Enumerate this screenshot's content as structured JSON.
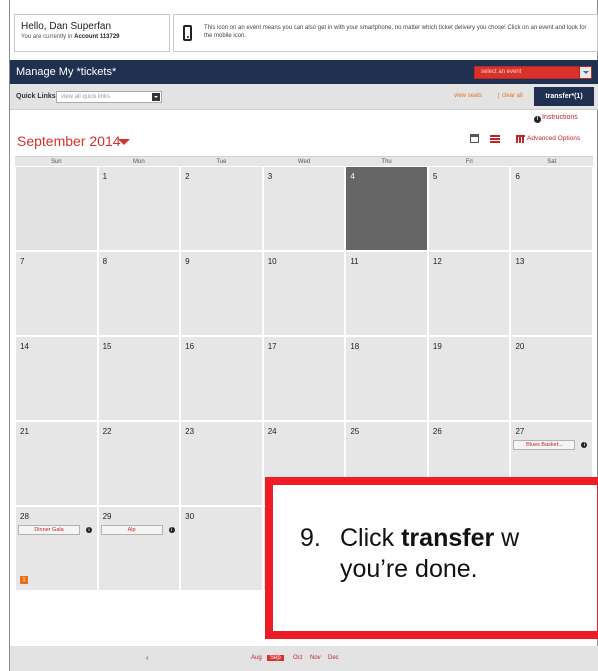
{
  "header": {
    "greeting": "Hello, Dan Superfan",
    "account_prefix": "You are currently in ",
    "account": "Account 113729",
    "notice": "This icon on an event means you can also get in with your smartphone, no matter which ticket delivery you chose! Click on an event and look for the mobile icon."
  },
  "manage": {
    "title": "Manage My *tickets*",
    "event_select_placeholder": "select an event"
  },
  "quick_links": {
    "label": "Quick Links",
    "select_placeholder": "view all quick links"
  },
  "actions": {
    "view_seats": "view seats",
    "separator": "|",
    "clear_all": "clear all",
    "transfer": "transfer*(1)",
    "instructions": "Instructions"
  },
  "calendar": {
    "month": "September 2014",
    "advanced_options": "Advanced Options",
    "days_of_week": [
      "Sun",
      "Mon",
      "Tue",
      "Wed",
      "Thu",
      "Fri",
      "Sat"
    ],
    "weeks": [
      [
        "",
        "1",
        "2",
        "3",
        "4",
        "5",
        "6"
      ],
      [
        "7",
        "8",
        "9",
        "10",
        "11",
        "12",
        "13"
      ],
      [
        "14",
        "15",
        "16",
        "17",
        "18",
        "19",
        "20"
      ],
      [
        "21",
        "22",
        "23",
        "24",
        "25",
        "26",
        "27"
      ],
      [
        "28",
        "29",
        "30",
        "",
        "",
        "",
        ""
      ]
    ],
    "today": "4",
    "events": {
      "blues": "Blues Basket...",
      "dinner": "Dinner Gala",
      "alp": "Alp"
    },
    "badge_count": "1"
  },
  "month_nav": {
    "prev": "‹",
    "months": [
      "Aug",
      "Sep",
      "Oct",
      "Nov",
      "Dec"
    ],
    "active": "Sep"
  },
  "callout": {
    "step": "9.",
    "text_before": "Click ",
    "bold_word": "transfer",
    "text_after": " w",
    "line2": "you’re done."
  },
  "colors": {
    "navy": "#1f3050",
    "accent_red": "#d8322a",
    "orange": "#e2721b",
    "callout_border": "#ee1c25"
  }
}
